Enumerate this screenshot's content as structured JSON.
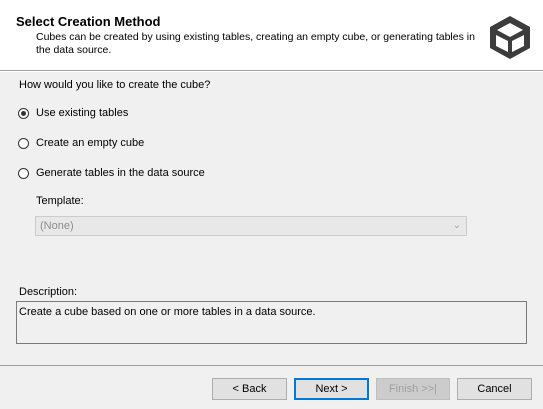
{
  "header": {
    "title": "Select Creation Method",
    "description": "Cubes can be created by using existing tables, creating an empty cube, or generating tables in the data source.",
    "icon": "cube-icon"
  },
  "question": "How would you like to create the cube?",
  "options": [
    {
      "label": "Use existing tables",
      "checked": true
    },
    {
      "label": "Create an empty cube",
      "checked": false
    },
    {
      "label": "Generate tables in the data source",
      "checked": false
    }
  ],
  "template": {
    "label": "Template:",
    "selected": "(None)",
    "enabled": false
  },
  "description": {
    "label": "Description:",
    "text": "Create a cube based on one or more tables in a data source."
  },
  "buttons": {
    "back": "< Back",
    "next": "Next >",
    "finish": "Finish >>|",
    "cancel": "Cancel"
  }
}
